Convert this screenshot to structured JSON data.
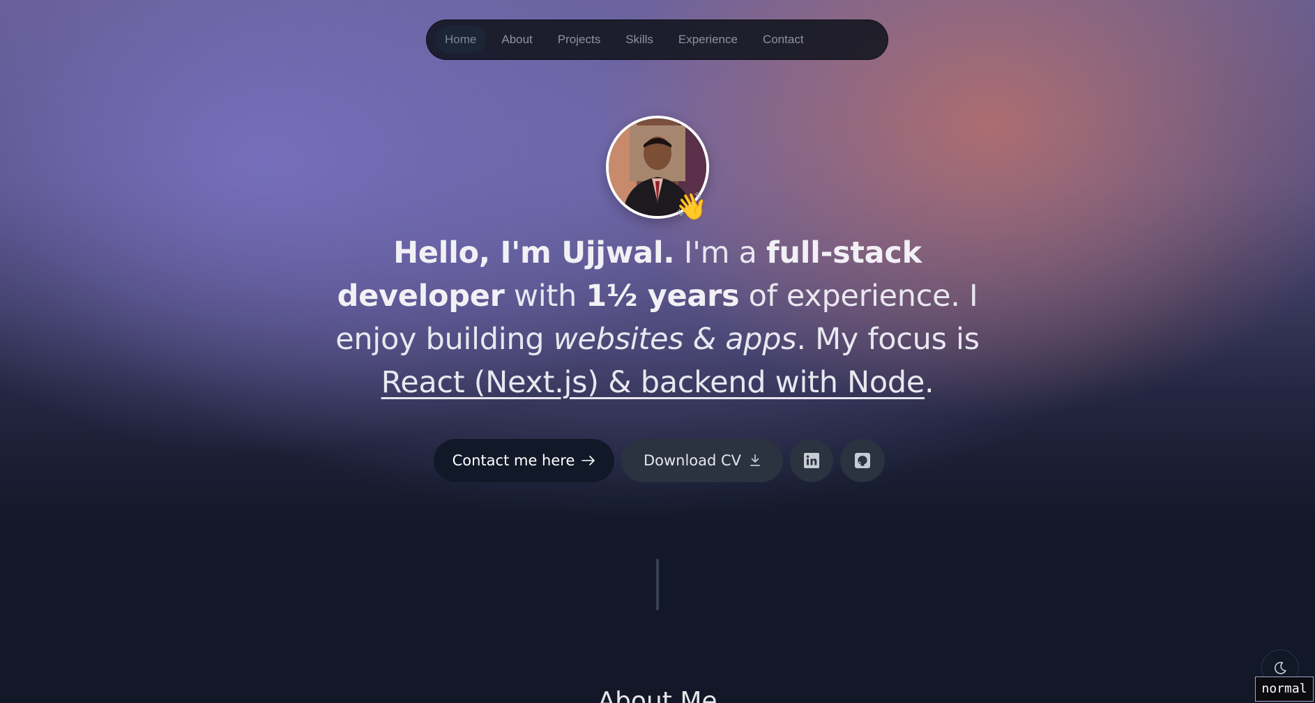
{
  "nav": {
    "items": [
      {
        "label": "Home",
        "active": true
      },
      {
        "label": "About"
      },
      {
        "label": "Projects"
      },
      {
        "label": "Skills"
      },
      {
        "label": "Experience"
      },
      {
        "label": "Contact"
      }
    ]
  },
  "avatar": {
    "icon": "profile-photo",
    "badge_emoji": "👋"
  },
  "hero": {
    "greeting": "Hello, I'm Ujjwal.",
    "t1": " I'm a ",
    "role": "full-stack developer",
    "t2": " with ",
    "experience": "1½ years",
    "t3": " of experience. I enjoy building ",
    "focus_items": "websites & apps",
    "t4": ". My focus is ",
    "stack": "React (Next.js) & backend with Node",
    "t5": "."
  },
  "buttons": {
    "contact_label": "Contact me here",
    "contact_icon": "arrow-right-icon",
    "cv_label": "Download CV",
    "cv_icon": "download-icon",
    "linkedin_icon": "linkedin-icon",
    "github_icon": "github-icon"
  },
  "about": {
    "title": "About Me"
  },
  "theme": {
    "icon": "moon-icon"
  },
  "mode_badge": "normal",
  "colors": {
    "background": "#121828",
    "glow_left": "#7870be",
    "glow_right": "#b06e6e",
    "button_dark": "#111827",
    "button_gray": "#2b3240"
  }
}
